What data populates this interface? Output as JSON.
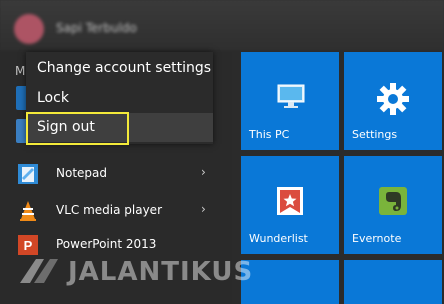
{
  "header": {
    "user_name": "Sapi Terbuldo"
  },
  "section_letter": "M",
  "account_menu": {
    "items": [
      {
        "label": "Change account settings"
      },
      {
        "label": "Lock"
      },
      {
        "label": "Sign out"
      }
    ]
  },
  "apps": [
    {
      "label": "Notepad",
      "has_submenu": true,
      "icon": "notepad-icon"
    },
    {
      "label": "VLC media player",
      "has_submenu": true,
      "icon": "vlc-icon"
    },
    {
      "label": "PowerPoint 2013",
      "has_submenu": false,
      "icon": "powerpoint-icon"
    }
  ],
  "tiles": [
    {
      "label": "This PC",
      "icon": "computer-icon"
    },
    {
      "label": "Settings",
      "icon": "gear-icon"
    },
    {
      "label": "Wunderlist",
      "icon": "wunderlist-icon"
    },
    {
      "label": "Evernote",
      "icon": "evernote-icon"
    }
  ],
  "watermark": {
    "text": "JALANTIKUS"
  },
  "colors": {
    "tile": "#0a78d7",
    "highlight": "#f4ea3a",
    "menu_bg": "#2b2b2b"
  }
}
